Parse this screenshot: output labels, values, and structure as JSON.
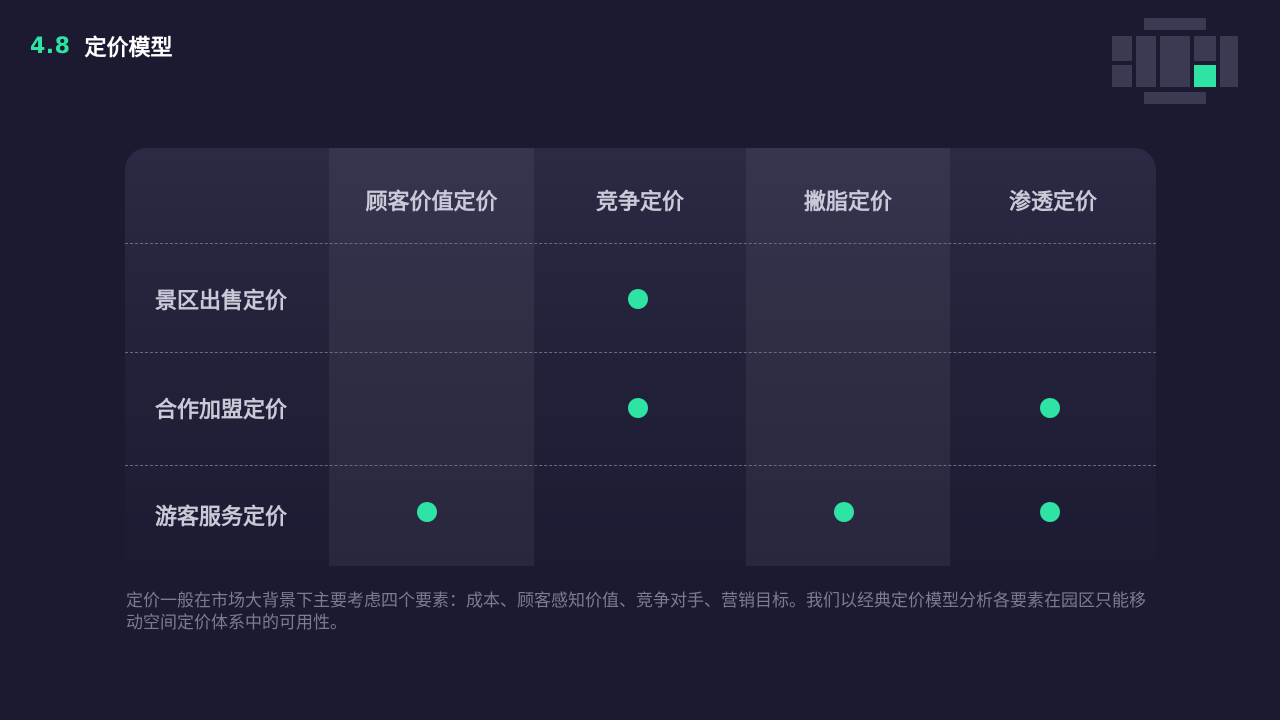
{
  "header": {
    "number": "4.8",
    "title": "定价模型"
  },
  "matrix": {
    "columns": [
      "顾客价值定价",
      "竞争定价",
      "撇脂定价",
      "渗透定价"
    ],
    "rows": [
      {
        "label": "景区出售定价",
        "marks": [
          false,
          true,
          false,
          false
        ]
      },
      {
        "label": "合作加盟定价",
        "marks": [
          false,
          true,
          false,
          true
        ]
      },
      {
        "label": "游客服务定价",
        "marks": [
          true,
          false,
          true,
          true
        ]
      }
    ]
  },
  "description": "定价一般在市场大背景下主要考虑四个要素：成本、顾客感知价值、竞争对手、营销目标。我们以经典定价模型分析各要素在园区只能移动空间定价体系中的可用性。",
  "colors": {
    "background": "#1b1a30",
    "accent": "#2ee3a4",
    "panel": "#2b2a45",
    "text_light": "#c9c9d8",
    "text_muted": "#7b7b94"
  }
}
